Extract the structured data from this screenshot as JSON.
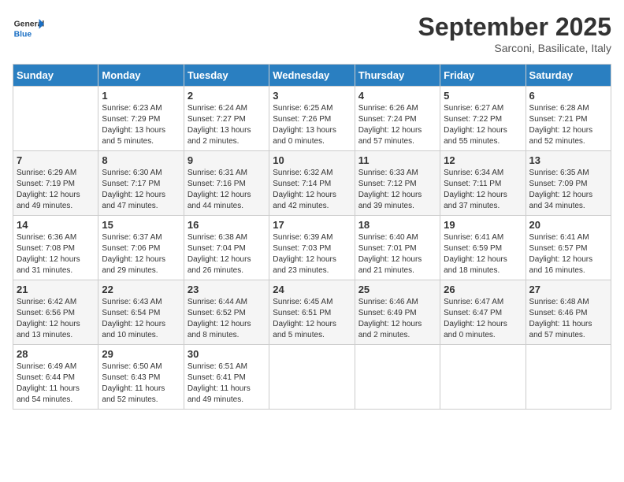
{
  "header": {
    "logo_general": "General",
    "logo_blue": "Blue",
    "month_title": "September 2025",
    "location": "Sarconi, Basilicate, Italy"
  },
  "days_of_week": [
    "Sunday",
    "Monday",
    "Tuesday",
    "Wednesday",
    "Thursday",
    "Friday",
    "Saturday"
  ],
  "weeks": [
    [
      {
        "day": "",
        "info": ""
      },
      {
        "day": "1",
        "info": "Sunrise: 6:23 AM\nSunset: 7:29 PM\nDaylight: 13 hours\nand 5 minutes."
      },
      {
        "day": "2",
        "info": "Sunrise: 6:24 AM\nSunset: 7:27 PM\nDaylight: 13 hours\nand 2 minutes."
      },
      {
        "day": "3",
        "info": "Sunrise: 6:25 AM\nSunset: 7:26 PM\nDaylight: 13 hours\nand 0 minutes."
      },
      {
        "day": "4",
        "info": "Sunrise: 6:26 AM\nSunset: 7:24 PM\nDaylight: 12 hours\nand 57 minutes."
      },
      {
        "day": "5",
        "info": "Sunrise: 6:27 AM\nSunset: 7:22 PM\nDaylight: 12 hours\nand 55 minutes."
      },
      {
        "day": "6",
        "info": "Sunrise: 6:28 AM\nSunset: 7:21 PM\nDaylight: 12 hours\nand 52 minutes."
      }
    ],
    [
      {
        "day": "7",
        "info": "Sunrise: 6:29 AM\nSunset: 7:19 PM\nDaylight: 12 hours\nand 49 minutes."
      },
      {
        "day": "8",
        "info": "Sunrise: 6:30 AM\nSunset: 7:17 PM\nDaylight: 12 hours\nand 47 minutes."
      },
      {
        "day": "9",
        "info": "Sunrise: 6:31 AM\nSunset: 7:16 PM\nDaylight: 12 hours\nand 44 minutes."
      },
      {
        "day": "10",
        "info": "Sunrise: 6:32 AM\nSunset: 7:14 PM\nDaylight: 12 hours\nand 42 minutes."
      },
      {
        "day": "11",
        "info": "Sunrise: 6:33 AM\nSunset: 7:12 PM\nDaylight: 12 hours\nand 39 minutes."
      },
      {
        "day": "12",
        "info": "Sunrise: 6:34 AM\nSunset: 7:11 PM\nDaylight: 12 hours\nand 37 minutes."
      },
      {
        "day": "13",
        "info": "Sunrise: 6:35 AM\nSunset: 7:09 PM\nDaylight: 12 hours\nand 34 minutes."
      }
    ],
    [
      {
        "day": "14",
        "info": "Sunrise: 6:36 AM\nSunset: 7:08 PM\nDaylight: 12 hours\nand 31 minutes."
      },
      {
        "day": "15",
        "info": "Sunrise: 6:37 AM\nSunset: 7:06 PM\nDaylight: 12 hours\nand 29 minutes."
      },
      {
        "day": "16",
        "info": "Sunrise: 6:38 AM\nSunset: 7:04 PM\nDaylight: 12 hours\nand 26 minutes."
      },
      {
        "day": "17",
        "info": "Sunrise: 6:39 AM\nSunset: 7:03 PM\nDaylight: 12 hours\nand 23 minutes."
      },
      {
        "day": "18",
        "info": "Sunrise: 6:40 AM\nSunset: 7:01 PM\nDaylight: 12 hours\nand 21 minutes."
      },
      {
        "day": "19",
        "info": "Sunrise: 6:41 AM\nSunset: 6:59 PM\nDaylight: 12 hours\nand 18 minutes."
      },
      {
        "day": "20",
        "info": "Sunrise: 6:41 AM\nSunset: 6:57 PM\nDaylight: 12 hours\nand 16 minutes."
      }
    ],
    [
      {
        "day": "21",
        "info": "Sunrise: 6:42 AM\nSunset: 6:56 PM\nDaylight: 12 hours\nand 13 minutes."
      },
      {
        "day": "22",
        "info": "Sunrise: 6:43 AM\nSunset: 6:54 PM\nDaylight: 12 hours\nand 10 minutes."
      },
      {
        "day": "23",
        "info": "Sunrise: 6:44 AM\nSunset: 6:52 PM\nDaylight: 12 hours\nand 8 minutes."
      },
      {
        "day": "24",
        "info": "Sunrise: 6:45 AM\nSunset: 6:51 PM\nDaylight: 12 hours\nand 5 minutes."
      },
      {
        "day": "25",
        "info": "Sunrise: 6:46 AM\nSunset: 6:49 PM\nDaylight: 12 hours\nand 2 minutes."
      },
      {
        "day": "26",
        "info": "Sunrise: 6:47 AM\nSunset: 6:47 PM\nDaylight: 12 hours\nand 0 minutes."
      },
      {
        "day": "27",
        "info": "Sunrise: 6:48 AM\nSunset: 6:46 PM\nDaylight: 11 hours\nand 57 minutes."
      }
    ],
    [
      {
        "day": "28",
        "info": "Sunrise: 6:49 AM\nSunset: 6:44 PM\nDaylight: 11 hours\nand 54 minutes."
      },
      {
        "day": "29",
        "info": "Sunrise: 6:50 AM\nSunset: 6:43 PM\nDaylight: 11 hours\nand 52 minutes."
      },
      {
        "day": "30",
        "info": "Sunrise: 6:51 AM\nSunset: 6:41 PM\nDaylight: 11 hours\nand 49 minutes."
      },
      {
        "day": "",
        "info": ""
      },
      {
        "day": "",
        "info": ""
      },
      {
        "day": "",
        "info": ""
      },
      {
        "day": "",
        "info": ""
      }
    ]
  ]
}
